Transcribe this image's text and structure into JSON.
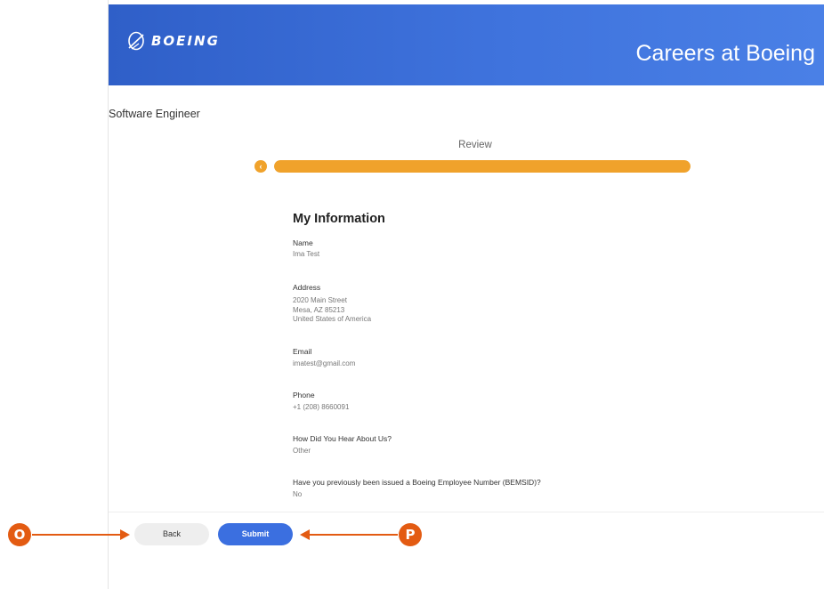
{
  "header": {
    "logo_text": "BOEING",
    "title": "Careers at Boeing"
  },
  "job": {
    "title": "Software Engineer"
  },
  "progress": {
    "step_label": "Review",
    "back_glyph": "‹",
    "fill_fraction": 1.0
  },
  "section": {
    "title": "My Information"
  },
  "fields": {
    "name": {
      "label": "Name",
      "value": "Ima Test"
    },
    "address": {
      "label": "Address",
      "lines": [
        "2020 Main Street",
        "Mesa, AZ 85213",
        "United States of America"
      ]
    },
    "email": {
      "label": "Email",
      "value": "imatest@gmail.com"
    },
    "phone": {
      "label": "Phone",
      "value": "+1 (208) 8660091"
    },
    "hear": {
      "label": "How Did You Hear About Us?",
      "value": "Other"
    },
    "bemsid": {
      "label": "Have you previously been issued a Boeing Employee Number (BEMSID)?",
      "value": "No"
    }
  },
  "buttons": {
    "back": "Back",
    "submit": "Submit"
  },
  "callouts": {
    "o": "O",
    "p": "P"
  },
  "colors": {
    "header_blue": "#3b6fe0",
    "progress_orange": "#f0a22b",
    "callout_orange": "#e35b12",
    "submit_blue": "#3b6fe0"
  },
  "icons": {
    "logo": "boeing-logo-icon",
    "back_step": "chevron-left-icon",
    "arrow": "arrow-icon"
  }
}
